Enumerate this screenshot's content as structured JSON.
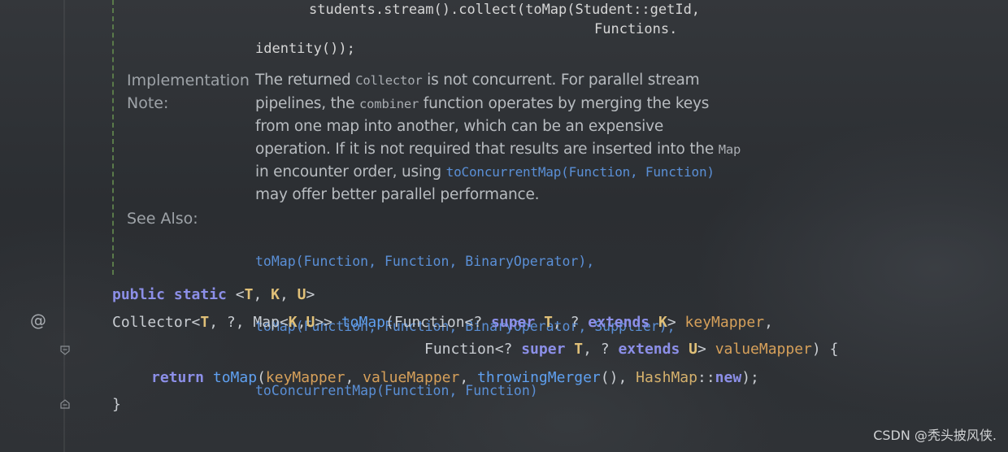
{
  "doc": {
    "example_line1": "students.stream().collect(toMap(Student::getId,",
    "example_line2": "Functions.",
    "example_line3": "identity());",
    "impl_label_1": "Implementation",
    "impl_label_2": "Note:",
    "impl": {
      "t1": "The returned ",
      "c1": "Collector",
      "t2": " is not concurrent. For parallel stream pipelines, the ",
      "c2": "combiner",
      "t3": " function operates by merging the keys from one map into another, which can be an expensive operation. If it is not required that results are inserted into the ",
      "c3": "Map",
      "t4": " in encounter order, using ",
      "l1": "toConcurrentMap(Function, Function)",
      "t5": " may offer better parallel performance."
    },
    "see_also_label": "See Also:",
    "see_also": [
      "toMap(Function, Function, BinaryOperator),",
      "toMap(Function, Function, BinaryOperator, Supplier),",
      "toConcurrentMap(Function, Function)"
    ]
  },
  "code": {
    "l1_public": "public",
    "l1_static": "static",
    "l1_lt": "<",
    "l1_T": "T",
    "l1_comma1": ", ",
    "l1_K": "K",
    "l1_comma2": ", ",
    "l1_U": "U",
    "l1_gt": ">",
    "l2_a": "Collector<",
    "l2_T": "T",
    "l2_b": ", ?, Map<",
    "l2_K": "K",
    "l2_c": ",",
    "l2_U": "U",
    "l2_d": ">> ",
    "l2_fn": "toMap",
    "l2_e": "(Function<? ",
    "l2_super": "super",
    "l2_sp1": " ",
    "l2_T2": "T",
    "l2_f": ", ? ",
    "l2_extends": "extends",
    "l2_sp2": " ",
    "l2_K2": "K",
    "l2_g": "> ",
    "l2_param": "keyMapper",
    "l2_h": ",",
    "l3_a": "Function<? ",
    "l3_super": "super",
    "l3_sp1": " ",
    "l3_T": "T",
    "l3_b": ", ? ",
    "l3_extends": "extends",
    "l3_sp2": " ",
    "l3_U": "U",
    "l3_c": "> ",
    "l3_param": "valueMapper",
    "l3_d": ") {",
    "l4_return": "return",
    "l4_sp": " ",
    "l4_fn": "toMap",
    "l4_a": "(",
    "l4_p1": "keyMapper",
    "l4_b": ", ",
    "l4_p2": "valueMapper",
    "l4_c": ", ",
    "l4_fn2": "throwingMerger",
    "l4_d": "(), ",
    "l4_cls": "HashMap",
    "l4_e": "::",
    "l4_new": "new",
    "l4_f": ");",
    "l5": "}"
  },
  "gutter": {
    "override_symbol": "@"
  },
  "watermark": "CSDN @秃头披风侠."
}
